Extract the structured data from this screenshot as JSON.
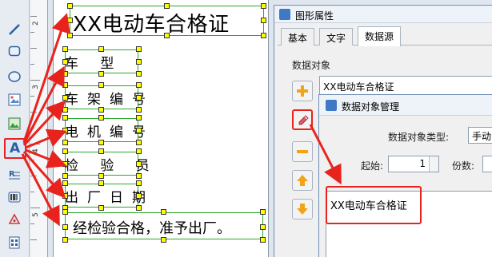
{
  "left_toolbar": {
    "tools": [
      {
        "icon": "line-icon"
      },
      {
        "icon": "rounded-rect-icon"
      },
      {
        "icon": "ellipse-icon"
      },
      {
        "icon": "image-icon"
      },
      {
        "icon": "picture-icon"
      },
      {
        "icon": "text-tool-icon",
        "glyph": "A",
        "selected": true
      },
      {
        "icon": "rich-text-icon"
      },
      {
        "icon": "barcode-icon"
      },
      {
        "icon": "qrcode-icon"
      },
      {
        "icon": "data-icon"
      }
    ]
  },
  "ruler": {
    "labels": [
      "2",
      "3",
      "4",
      "5"
    ]
  },
  "label_canvas": {
    "title": "XX电动车合格证",
    "rows": [
      "车    型",
      "车架编号",
      "电机编号",
      "检 验 员",
      "出厂日期"
    ],
    "footer": "经检验合格，准予出厂。"
  },
  "properties_dialog": {
    "title": "图形属性",
    "tabs": [
      "基本",
      "文字",
      "数据源"
    ],
    "selected_tab": "数据源",
    "group_label": "数据对象",
    "data_object_item": "XX电动车合格证",
    "side_buttons": [
      "add-icon",
      "edit-icon",
      "remove-icon",
      "move-up-icon",
      "move-down-icon"
    ]
  },
  "data_manager_dialog": {
    "title": "数据对象管理",
    "type_label": "数据对象类型:",
    "type_value": "手动",
    "start_label": "起始:",
    "start_value": "1",
    "copies_label": "份数:",
    "content_value": "XX电动车合格证"
  },
  "colors": {
    "highlight_red": "#e8231e",
    "handle_yellow": "#ffff00",
    "selection_green": "#2aa82a"
  }
}
